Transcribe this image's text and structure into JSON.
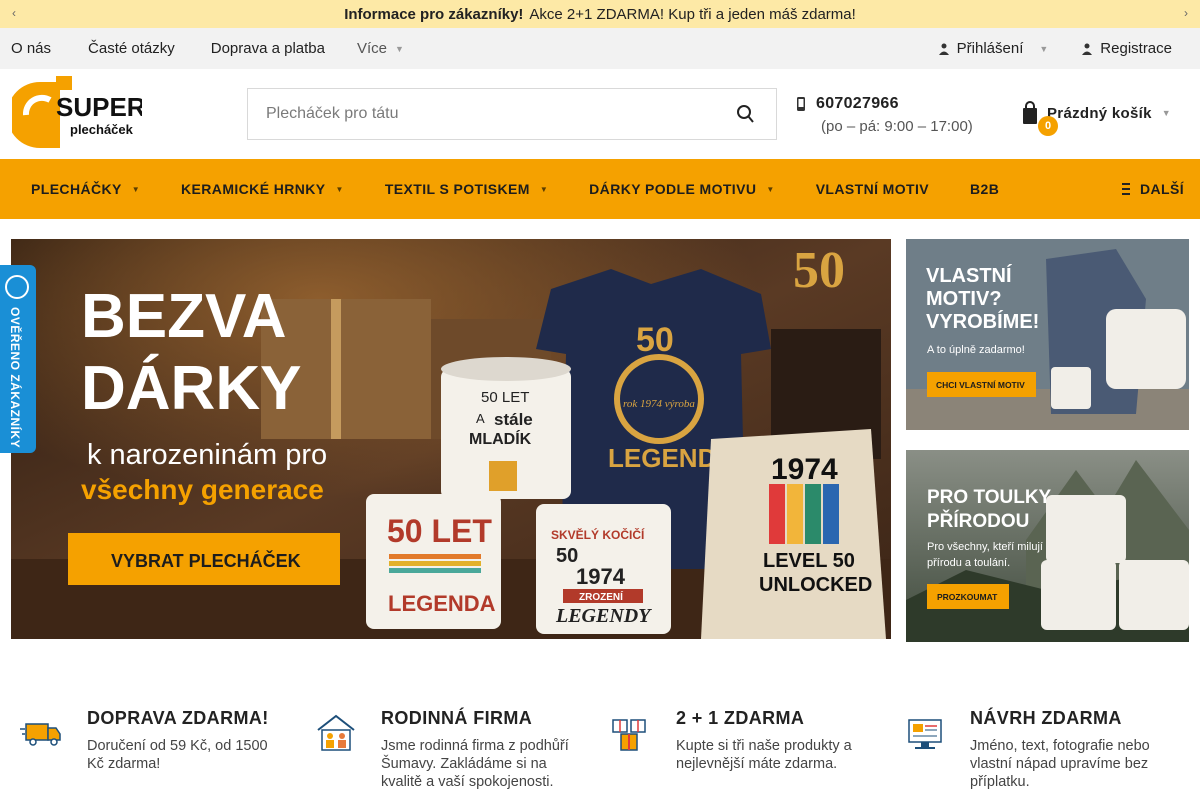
{
  "announcement": {
    "prev_icon": "chevron-left-icon",
    "next_icon": "chevron-right-icon",
    "title": "Informace pro zákazníky!",
    "text": "Akce 2+1 ZDARMA! Kup tři a jeden máš zdarma!"
  },
  "toplinks": {
    "items": [
      "O nás",
      "Časté otázky",
      "Doprava a platba",
      "Více"
    ],
    "login": "Přihlášení",
    "register": "Registrace"
  },
  "header": {
    "logo_word1": "SUPER",
    "logo_word2": "plecháček",
    "search_placeholder": "Plecháček pro tátu",
    "phone": "607027966",
    "hours": "(po – pá: 9:00 – 17:00)",
    "cart_label": "Prázdný košík",
    "cart_count": "0"
  },
  "nav": {
    "items": [
      "PLECHÁČKY",
      "KERAMICKÉ HRNKY",
      "TEXTIL S POTISKEM",
      "DÁRKY PODLE MOTIVU",
      "VLASTNÍ MOTIV",
      "B2B"
    ],
    "more": "DALŠÍ"
  },
  "hero": {
    "line1": "BEZVA",
    "line2": "DÁRKY",
    "line3": "k narozeninám pro",
    "line4": "všechny generace",
    "button": "VYBRAT PLECHÁČEK",
    "mug1": [
      "50 LET",
      "A",
      "stále",
      "MLADÍK"
    ],
    "shirt": [
      "50",
      "rok 1974 výroba",
      "LEGENDU"
    ],
    "mug2": [
      "50 LET",
      "LEGENDA"
    ],
    "mug3": [
      "SKVĚLÝ KOČIČÍ",
      "50",
      "1974",
      "ZROZENÍ",
      "LEGENDY"
    ],
    "hoodie": [
      "1974",
      "LEVEL 50",
      "UNLOCKED"
    ],
    "cake_number": "50"
  },
  "side1": {
    "title1": "VLASTNÍ",
    "title2": "MOTIV?",
    "title3": "VYROBÍME!",
    "sub": "A to úplně zadarmo!",
    "button": "CHCI VLASTNÍ MOTIV"
  },
  "side2": {
    "title1": "PRO TOULKY",
    "title2": "PŘÍRODOU",
    "sub1": "Pro všechny, kteří milují",
    "sub2": "přírodu a toulání.",
    "button": "PROZKOUMAT"
  },
  "verified": {
    "text": "OVĚŘENO ZÁKAZNÍKY"
  },
  "features": [
    {
      "icon": "delivery-truck-icon",
      "title": "DOPRAVA ZDARMA!",
      "desc": "Doručení od 59 Kč, od 1500 Kč zdarma!"
    },
    {
      "icon": "family-home-icon",
      "title": "RODINNÁ FIRMA",
      "desc": "Jsme rodinná firma z podhůří Šumavy. Zakládáme si na kvalitě a vaší spokojenosti."
    },
    {
      "icon": "gifts-icon",
      "title": "2 + 1 ZDARMA",
      "desc": "Kupte si tři naše produkty a nejlevnější máte zdarma."
    },
    {
      "icon": "design-computer-icon",
      "title": "NÁVRH ZDARMA",
      "desc": "Jméno, text, fotografie nebo vlastní nápad upravíme bez příplatku."
    }
  ],
  "colors": {
    "accent": "#f5a100",
    "announce_bg": "#fde9a6",
    "verified_blue": "#1a8fd6"
  }
}
